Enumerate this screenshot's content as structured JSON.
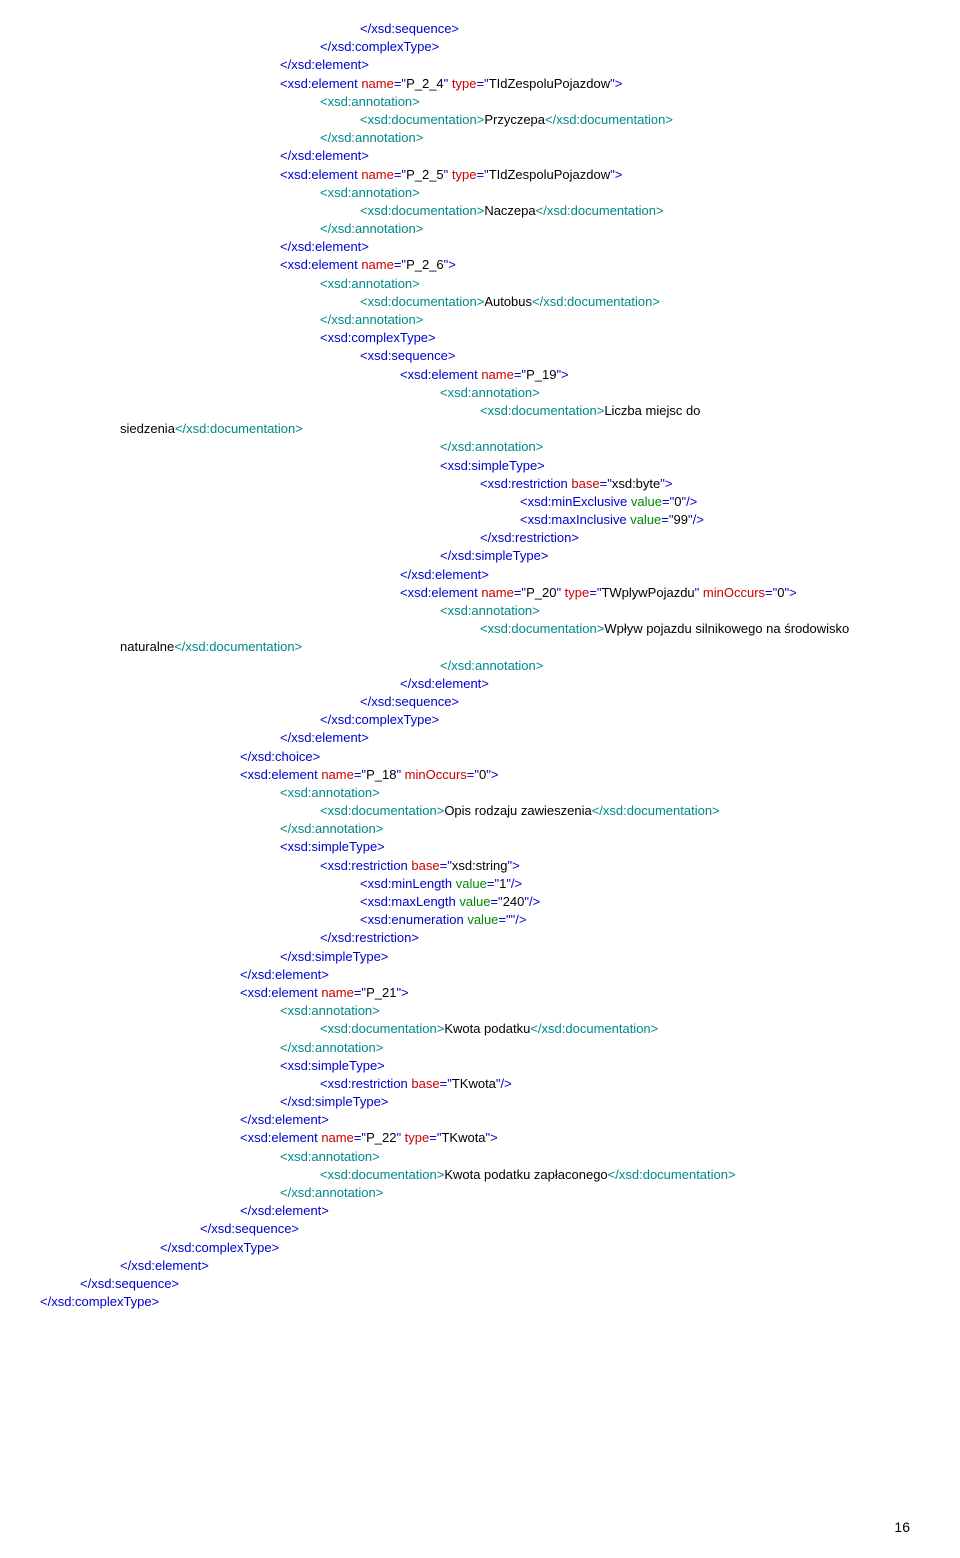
{
  "lines": [
    {
      "indent": 24,
      "spans": [
        {
          "t": "</xsd:sequence>",
          "c": "blue"
        }
      ]
    },
    {
      "indent": 20,
      "spans": [
        {
          "t": "</xsd:complexType>",
          "c": "blue"
        }
      ]
    },
    {
      "indent": 16,
      "spans": [
        {
          "t": "</xsd:element>",
          "c": "blue"
        }
      ]
    },
    {
      "indent": 16,
      "spans": [
        {
          "t": "<xsd:element",
          "c": "blue"
        },
        {
          "t": " ",
          "c": ""
        },
        {
          "t": "name",
          "c": "red"
        },
        {
          "t": "=\"",
          "c": "blue"
        },
        {
          "t": "P_2_4",
          "c": ""
        },
        {
          "t": "\" ",
          "c": "blue"
        },
        {
          "t": "type",
          "c": "red"
        },
        {
          "t": "=\"",
          "c": "blue"
        },
        {
          "t": "TIdZespoluPojazdow",
          "c": ""
        },
        {
          "t": "\">",
          "c": "blue"
        }
      ]
    },
    {
      "indent": 20,
      "spans": [
        {
          "t": "<xsd:annotation>",
          "c": "teal"
        }
      ]
    },
    {
      "indent": 24,
      "spans": [
        {
          "t": "<xsd:documentation>",
          "c": "teal"
        },
        {
          "t": "Przyczepa",
          "c": ""
        },
        {
          "t": "</xsd:documentation>",
          "c": "teal"
        }
      ]
    },
    {
      "indent": 20,
      "spans": [
        {
          "t": "</xsd:annotation>",
          "c": "teal"
        }
      ]
    },
    {
      "indent": 16,
      "spans": [
        {
          "t": "</xsd:element>",
          "c": "blue"
        }
      ]
    },
    {
      "indent": 16,
      "spans": [
        {
          "t": "<xsd:element",
          "c": "blue"
        },
        {
          "t": " ",
          "c": ""
        },
        {
          "t": "name",
          "c": "red"
        },
        {
          "t": "=\"",
          "c": "blue"
        },
        {
          "t": "P_2_5",
          "c": ""
        },
        {
          "t": "\" ",
          "c": "blue"
        },
        {
          "t": "type",
          "c": "red"
        },
        {
          "t": "=\"",
          "c": "blue"
        },
        {
          "t": "TIdZespoluPojazdow",
          "c": ""
        },
        {
          "t": "\">",
          "c": "blue"
        }
      ]
    },
    {
      "indent": 20,
      "spans": [
        {
          "t": "<xsd:annotation>",
          "c": "teal"
        }
      ]
    },
    {
      "indent": 24,
      "spans": [
        {
          "t": "<xsd:documentation>",
          "c": "teal"
        },
        {
          "t": "Naczepa",
          "c": ""
        },
        {
          "t": "</xsd:documentation>",
          "c": "teal"
        }
      ]
    },
    {
      "indent": 20,
      "spans": [
        {
          "t": "</xsd:annotation>",
          "c": "teal"
        }
      ]
    },
    {
      "indent": 16,
      "spans": [
        {
          "t": "</xsd:element>",
          "c": "blue"
        }
      ]
    },
    {
      "indent": 16,
      "spans": [
        {
          "t": "<xsd:element",
          "c": "blue"
        },
        {
          "t": " ",
          "c": ""
        },
        {
          "t": "name",
          "c": "red"
        },
        {
          "t": "=\"",
          "c": "blue"
        },
        {
          "t": "P_2_6",
          "c": ""
        },
        {
          "t": "\">",
          "c": "blue"
        }
      ]
    },
    {
      "indent": 20,
      "spans": [
        {
          "t": "<xsd:annotation>",
          "c": "teal"
        }
      ]
    },
    {
      "indent": 24,
      "spans": [
        {
          "t": "<xsd:documentation>",
          "c": "teal"
        },
        {
          "t": "Autobus",
          "c": ""
        },
        {
          "t": "</xsd:documentation>",
          "c": "teal"
        }
      ]
    },
    {
      "indent": 20,
      "spans": [
        {
          "t": "</xsd:annotation>",
          "c": "teal"
        }
      ]
    },
    {
      "indent": 20,
      "spans": [
        {
          "t": "<xsd:complexType>",
          "c": "blue"
        }
      ]
    },
    {
      "indent": 24,
      "spans": [
        {
          "t": "<xsd:sequence>",
          "c": "blue"
        }
      ]
    },
    {
      "indent": 28,
      "spans": [
        {
          "t": "<xsd:element",
          "c": "blue"
        },
        {
          "t": " ",
          "c": ""
        },
        {
          "t": "name",
          "c": "red"
        },
        {
          "t": "=\"",
          "c": "blue"
        },
        {
          "t": "P_19",
          "c": ""
        },
        {
          "t": "\">",
          "c": "blue"
        }
      ]
    },
    {
      "indent": 32,
      "spans": [
        {
          "t": "<xsd:annotation>",
          "c": "teal"
        }
      ]
    },
    {
      "indent": 36,
      "spans": [
        {
          "t": "<xsd:documentation>",
          "c": "teal"
        },
        {
          "t": "Liczba miejsc do",
          "c": ""
        }
      ]
    },
    {
      "indent": 0,
      "spans": [
        {
          "t": "siedzenia",
          "c": ""
        },
        {
          "t": "</xsd:documentation>",
          "c": "teal"
        }
      ]
    },
    {
      "indent": 32,
      "spans": [
        {
          "t": "</xsd:annotation>",
          "c": "teal"
        }
      ]
    },
    {
      "indent": 32,
      "spans": [
        {
          "t": "<xsd:simpleType>",
          "c": "blue"
        }
      ]
    },
    {
      "indent": 36,
      "spans": [
        {
          "t": "<xsd:restriction",
          "c": "blue"
        },
        {
          "t": " ",
          "c": ""
        },
        {
          "t": "base",
          "c": "red"
        },
        {
          "t": "=\"",
          "c": "blue"
        },
        {
          "t": "xsd:byte",
          "c": ""
        },
        {
          "t": "\">",
          "c": "blue"
        }
      ]
    },
    {
      "indent": 40,
      "spans": [
        {
          "t": "<xsd:minExclusive",
          "c": "blue"
        },
        {
          "t": " ",
          "c": ""
        },
        {
          "t": "value",
          "c": "green"
        },
        {
          "t": "=\"",
          "c": "blue"
        },
        {
          "t": "0",
          "c": ""
        },
        {
          "t": "\"/>",
          "c": "blue"
        }
      ]
    },
    {
      "indent": 40,
      "spans": [
        {
          "t": "<xsd:maxInclusive",
          "c": "blue"
        },
        {
          "t": " ",
          "c": ""
        },
        {
          "t": "value",
          "c": "green"
        },
        {
          "t": "=\"",
          "c": "blue"
        },
        {
          "t": "99",
          "c": ""
        },
        {
          "t": "\"/>",
          "c": "blue"
        }
      ]
    },
    {
      "indent": 36,
      "spans": [
        {
          "t": "</xsd:restriction>",
          "c": "blue"
        }
      ]
    },
    {
      "indent": 32,
      "spans": [
        {
          "t": "</xsd:simpleType>",
          "c": "blue"
        }
      ]
    },
    {
      "indent": 28,
      "spans": [
        {
          "t": "</xsd:element>",
          "c": "blue"
        }
      ]
    },
    {
      "indent": 28,
      "spans": [
        {
          "t": "<xsd:element",
          "c": "blue"
        },
        {
          "t": " ",
          "c": ""
        },
        {
          "t": "name",
          "c": "red"
        },
        {
          "t": "=\"",
          "c": "blue"
        },
        {
          "t": "P_20",
          "c": ""
        },
        {
          "t": "\" ",
          "c": "blue"
        },
        {
          "t": "type",
          "c": "red"
        },
        {
          "t": "=\"",
          "c": "blue"
        },
        {
          "t": "TWplywPojazdu",
          "c": ""
        },
        {
          "t": "\" ",
          "c": "blue"
        },
        {
          "t": "minOccurs",
          "c": "red"
        },
        {
          "t": "=\"",
          "c": "blue"
        },
        {
          "t": "0",
          "c": ""
        },
        {
          "t": "\">",
          "c": "blue"
        }
      ]
    },
    {
      "indent": 32,
      "spans": [
        {
          "t": "<xsd:annotation>",
          "c": "teal"
        }
      ]
    },
    {
      "indent": 36,
      "spans": [
        {
          "t": "<xsd:documentation>",
          "c": "teal"
        },
        {
          "t": "Wpływ pojazdu silnikowego na środowisko",
          "c": ""
        }
      ]
    },
    {
      "indent": 0,
      "spans": [
        {
          "t": "naturalne",
          "c": ""
        },
        {
          "t": "</xsd:documentation>",
          "c": "teal"
        }
      ]
    },
    {
      "indent": 32,
      "spans": [
        {
          "t": "</xsd:annotation>",
          "c": "teal"
        }
      ]
    },
    {
      "indent": 28,
      "spans": [
        {
          "t": "</xsd:element>",
          "c": "blue"
        }
      ]
    },
    {
      "indent": 24,
      "spans": [
        {
          "t": "</xsd:sequence>",
          "c": "blue"
        }
      ]
    },
    {
      "indent": 20,
      "spans": [
        {
          "t": "</xsd:complexType>",
          "c": "blue"
        }
      ]
    },
    {
      "indent": 16,
      "spans": [
        {
          "t": "</xsd:element>",
          "c": "blue"
        }
      ]
    },
    {
      "indent": 12,
      "spans": [
        {
          "t": "</xsd:choice>",
          "c": "blue"
        }
      ]
    },
    {
      "indent": 12,
      "spans": [
        {
          "t": "<xsd:element",
          "c": "blue"
        },
        {
          "t": " ",
          "c": ""
        },
        {
          "t": "name",
          "c": "red"
        },
        {
          "t": "=\"",
          "c": "blue"
        },
        {
          "t": "P_18",
          "c": ""
        },
        {
          "t": "\" ",
          "c": "blue"
        },
        {
          "t": "minOccurs",
          "c": "red"
        },
        {
          "t": "=\"",
          "c": "blue"
        },
        {
          "t": "0",
          "c": ""
        },
        {
          "t": "\">",
          "c": "blue"
        }
      ]
    },
    {
      "indent": 16,
      "spans": [
        {
          "t": "<xsd:annotation>",
          "c": "teal"
        }
      ]
    },
    {
      "indent": 20,
      "spans": [
        {
          "t": "<xsd:documentation>",
          "c": "teal"
        },
        {
          "t": "Opis rodzaju zawieszenia",
          "c": ""
        },
        {
          "t": "</xsd:documentation>",
          "c": "teal"
        }
      ]
    },
    {
      "indent": 16,
      "spans": [
        {
          "t": "</xsd:annotation>",
          "c": "teal"
        }
      ]
    },
    {
      "indent": 16,
      "spans": [
        {
          "t": "<xsd:simpleType>",
          "c": "blue"
        }
      ]
    },
    {
      "indent": 20,
      "spans": [
        {
          "t": "<xsd:restriction",
          "c": "blue"
        },
        {
          "t": " ",
          "c": ""
        },
        {
          "t": "base",
          "c": "red"
        },
        {
          "t": "=\"",
          "c": "blue"
        },
        {
          "t": "xsd:string",
          "c": ""
        },
        {
          "t": "\">",
          "c": "blue"
        }
      ]
    },
    {
      "indent": 24,
      "spans": [
        {
          "t": "<xsd:minLength",
          "c": "blue"
        },
        {
          "t": " ",
          "c": ""
        },
        {
          "t": "value",
          "c": "green"
        },
        {
          "t": "=\"",
          "c": "blue"
        },
        {
          "t": "1",
          "c": ""
        },
        {
          "t": "\"/>",
          "c": "blue"
        }
      ]
    },
    {
      "indent": 24,
      "spans": [
        {
          "t": "<xsd:maxLength",
          "c": "blue"
        },
        {
          "t": " ",
          "c": ""
        },
        {
          "t": "value",
          "c": "green"
        },
        {
          "t": "=\"",
          "c": "blue"
        },
        {
          "t": "240",
          "c": ""
        },
        {
          "t": "\"/>",
          "c": "blue"
        }
      ]
    },
    {
      "indent": 24,
      "spans": [
        {
          "t": "<xsd:enumeration",
          "c": "blue"
        },
        {
          "t": " ",
          "c": ""
        },
        {
          "t": "value",
          "c": "green"
        },
        {
          "t": "=\"\"",
          "c": "blue"
        },
        {
          "t": "/>",
          "c": "blue"
        }
      ]
    },
    {
      "indent": 20,
      "spans": [
        {
          "t": "</xsd:restriction>",
          "c": "blue"
        }
      ]
    },
    {
      "indent": 16,
      "spans": [
        {
          "t": "</xsd:simpleType>",
          "c": "blue"
        }
      ]
    },
    {
      "indent": 12,
      "spans": [
        {
          "t": "</xsd:element>",
          "c": "blue"
        }
      ]
    },
    {
      "indent": 12,
      "spans": [
        {
          "t": "<xsd:element",
          "c": "blue"
        },
        {
          "t": " ",
          "c": ""
        },
        {
          "t": "name",
          "c": "red"
        },
        {
          "t": "=\"",
          "c": "blue"
        },
        {
          "t": "P_21",
          "c": ""
        },
        {
          "t": "\">",
          "c": "blue"
        }
      ]
    },
    {
      "indent": 16,
      "spans": [
        {
          "t": "<xsd:annotation>",
          "c": "teal"
        }
      ]
    },
    {
      "indent": 20,
      "spans": [
        {
          "t": "<xsd:documentation>",
          "c": "teal"
        },
        {
          "t": "Kwota podatku",
          "c": ""
        },
        {
          "t": "</xsd:documentation>",
          "c": "teal"
        }
      ]
    },
    {
      "indent": 16,
      "spans": [
        {
          "t": "</xsd:annotation>",
          "c": "teal"
        }
      ]
    },
    {
      "indent": 16,
      "spans": [
        {
          "t": "<xsd:simpleType>",
          "c": "blue"
        }
      ]
    },
    {
      "indent": 20,
      "spans": [
        {
          "t": "<xsd:restriction",
          "c": "blue"
        },
        {
          "t": " ",
          "c": ""
        },
        {
          "t": "base",
          "c": "red"
        },
        {
          "t": "=\"",
          "c": "blue"
        },
        {
          "t": "TKwota",
          "c": ""
        },
        {
          "t": "\"/>",
          "c": "blue"
        }
      ]
    },
    {
      "indent": 16,
      "spans": [
        {
          "t": "</xsd:simpleType>",
          "c": "blue"
        }
      ]
    },
    {
      "indent": 12,
      "spans": [
        {
          "t": "</xsd:element>",
          "c": "blue"
        }
      ]
    },
    {
      "indent": 12,
      "spans": [
        {
          "t": "<xsd:element",
          "c": "blue"
        },
        {
          "t": " ",
          "c": ""
        },
        {
          "t": "name",
          "c": "red"
        },
        {
          "t": "=\"",
          "c": "blue"
        },
        {
          "t": "P_22",
          "c": ""
        },
        {
          "t": "\" ",
          "c": "blue"
        },
        {
          "t": "type",
          "c": "red"
        },
        {
          "t": "=\"",
          "c": "blue"
        },
        {
          "t": "TKwota",
          "c": ""
        },
        {
          "t": "\">",
          "c": "blue"
        }
      ]
    },
    {
      "indent": 16,
      "spans": [
        {
          "t": "<xsd:annotation>",
          "c": "teal"
        }
      ]
    },
    {
      "indent": 20,
      "spans": [
        {
          "t": "<xsd:documentation>",
          "c": "teal"
        },
        {
          "t": "Kwota podatku zapłaconego",
          "c": ""
        },
        {
          "t": "</xsd:documentation>",
          "c": "teal"
        }
      ]
    },
    {
      "indent": 16,
      "spans": [
        {
          "t": "</xsd:annotation>",
          "c": "teal"
        }
      ]
    },
    {
      "indent": 12,
      "spans": [
        {
          "t": "</xsd:element>",
          "c": "blue"
        }
      ]
    },
    {
      "indent": 8,
      "spans": [
        {
          "t": "</xsd:sequence>",
          "c": "blue"
        }
      ]
    },
    {
      "indent": 4,
      "spans": [
        {
          "t": "</xsd:complexType>",
          "c": "blue"
        }
      ]
    },
    {
      "indent": 0,
      "spans": [
        {
          "t": "</xsd:element>",
          "c": "blue"
        }
      ]
    },
    {
      "indent": -4,
      "spans": [
        {
          "t": "</xsd:sequence>",
          "c": "blue"
        }
      ]
    },
    {
      "indent": -8,
      "spans": [
        {
          "t": "</xsd:complexType>",
          "c": "blue"
        }
      ]
    }
  ],
  "pageNumber": "16",
  "baseIndent": 8
}
